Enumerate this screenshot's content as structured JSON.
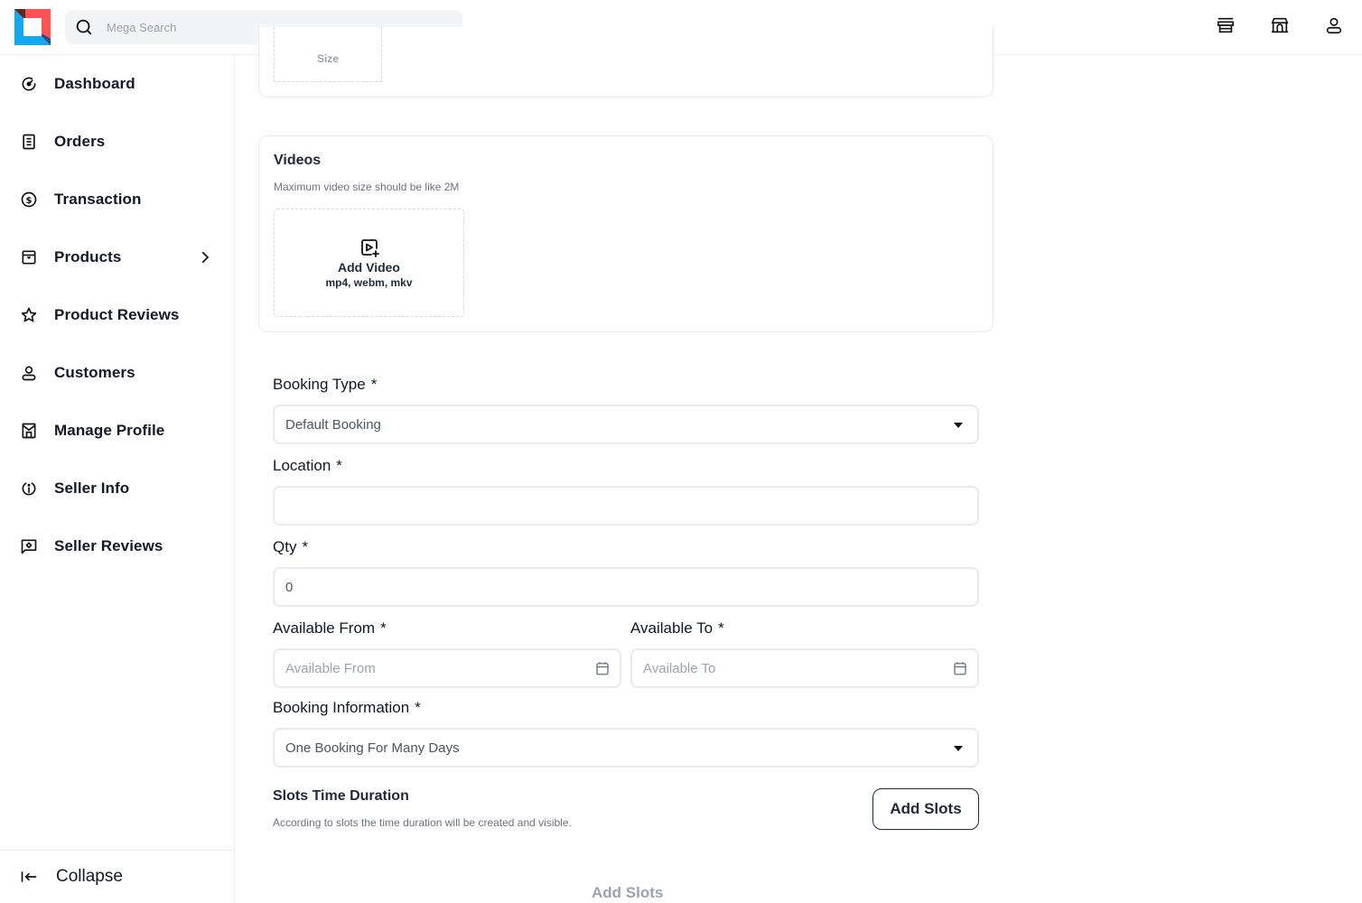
{
  "header": {
    "search_placeholder": "Mega Search",
    "icons": [
      "store-icon",
      "shop-building-icon",
      "user-icon"
    ]
  },
  "sidebar": {
    "items": [
      {
        "label": "Dashboard",
        "icon": "dashboard-gauge-icon"
      },
      {
        "label": "Orders",
        "icon": "orders-document-icon"
      },
      {
        "label": "Transaction",
        "icon": "dollar-circle-icon"
      },
      {
        "label": "Products",
        "icon": "product-box-icon",
        "has_submenu": true
      },
      {
        "label": "Product Reviews",
        "icon": "star-icon"
      },
      {
        "label": "Customers",
        "icon": "user-icon"
      },
      {
        "label": "Manage Profile",
        "icon": "store-profile-icon"
      },
      {
        "label": "Seller Info",
        "icon": "info-icon"
      },
      {
        "label": "Seller Reviews",
        "icon": "review-chat-icon"
      }
    ],
    "collapse_label": "Collapse"
  },
  "previous_card": {
    "size_label": "Size"
  },
  "videos": {
    "title": "Videos",
    "subtitle": "Maximum video size should be like 2M",
    "add_label": "Add Video",
    "formats": "mp4, webm, mkv"
  },
  "form": {
    "required_mark": "*",
    "booking_type": {
      "label": "Booking Type",
      "value": "Default Booking"
    },
    "location": {
      "label": "Location",
      "value": ""
    },
    "qty": {
      "label": "Qty",
      "value": "0"
    },
    "available_from": {
      "label": "Available From",
      "placeholder": "Available From"
    },
    "available_to": {
      "label": "Available To",
      "placeholder": "Available To"
    },
    "booking_information": {
      "label": "Booking Information",
      "value": "One Booking For Many Days"
    }
  },
  "slots": {
    "title": "Slots Time Duration",
    "subtitle": "According to slots the time duration will be created and visible.",
    "button_label": "Add Slots",
    "footer_label": "Add Slots"
  }
}
